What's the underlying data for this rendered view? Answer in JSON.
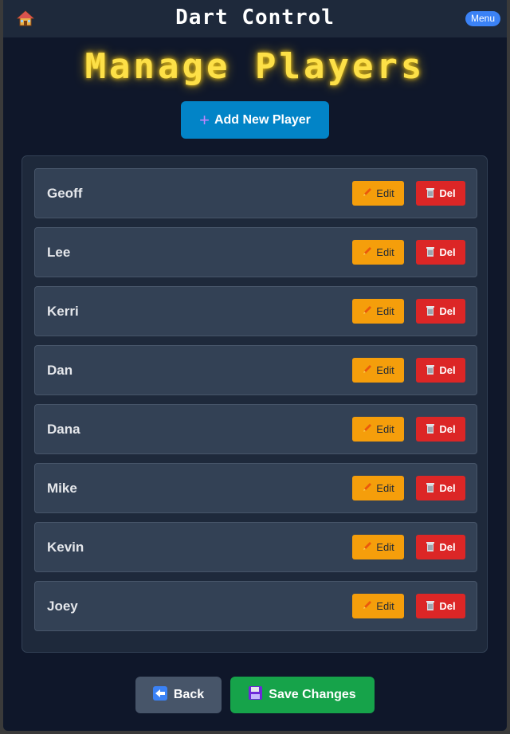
{
  "header": {
    "title": "Dart Control",
    "menu_label": "Menu",
    "home_icon": "home-icon"
  },
  "page": {
    "heading": "Manage Players",
    "add_button": "Add New Player"
  },
  "players": [
    {
      "name": "Geoff",
      "edit_label": "Edit",
      "delete_label": "Del"
    },
    {
      "name": "Lee",
      "edit_label": "Edit",
      "delete_label": "Del"
    },
    {
      "name": "Kerri",
      "edit_label": "Edit",
      "delete_label": "Del"
    },
    {
      "name": "Dan",
      "edit_label": "Edit",
      "delete_label": "Del"
    },
    {
      "name": "Dana",
      "edit_label": "Edit",
      "delete_label": "Del"
    },
    {
      "name": "Mike",
      "edit_label": "Edit",
      "delete_label": "Del"
    },
    {
      "name": "Kevin",
      "edit_label": "Edit",
      "delete_label": "Del"
    },
    {
      "name": "Joey",
      "edit_label": "Edit",
      "delete_label": "Del"
    }
  ],
  "footer": {
    "back_label": "Back",
    "save_label": "Save Changes"
  },
  "colors": {
    "background": "#0f172a",
    "heading_glow": "#fde047",
    "add_button": "#0284c7",
    "edit_button": "#f59e0b",
    "delete_button": "#dc2626",
    "save_button": "#16a34a",
    "back_button": "#475569"
  }
}
